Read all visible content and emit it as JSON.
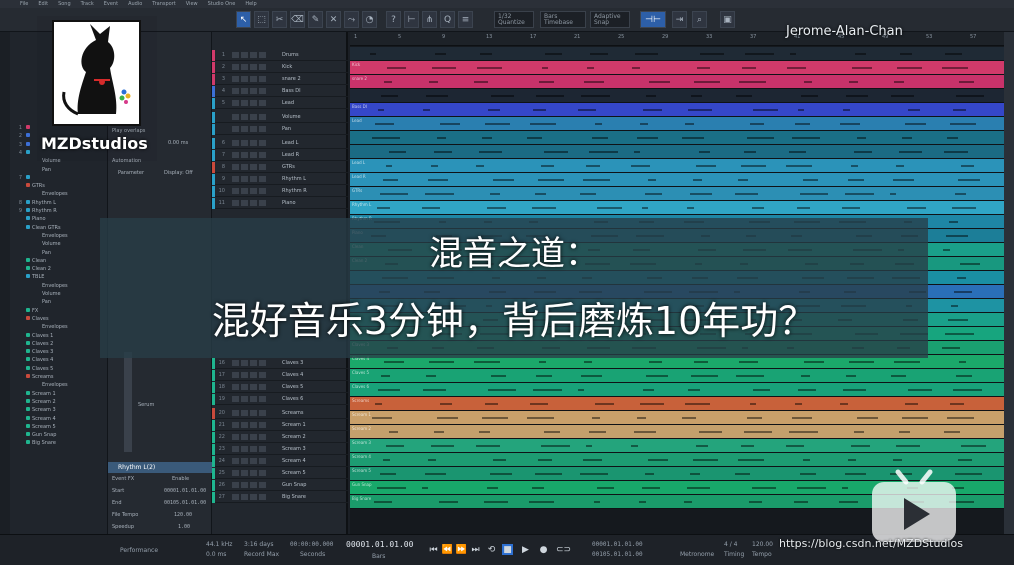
{
  "menu": [
    "File",
    "Edit",
    "Song",
    "Track",
    "Event",
    "Audio",
    "Transport",
    "View",
    "Studio One",
    "Help"
  ],
  "toolbar": {
    "quantize_value": "1/32",
    "quantize_label": "Quantize",
    "timebase_value": "Bars",
    "timebase_label": "Timebase",
    "snap_value": "Adaptive",
    "snap_label": "Snap"
  },
  "overlay": {
    "brand": "MZDstudios",
    "author": "Jerome-Alan-Chan",
    "title_line1": "混音之道：",
    "title_line2": "混好音乐3分钟，背后磨炼10年功？",
    "watermark": "https://blog.csdn.net/MZDStudios"
  },
  "browser": {
    "rows": [
      {
        "num": "1",
        "label": "",
        "color": "#d13a6a"
      },
      {
        "num": "2",
        "label": "",
        "color": "#3c6fd6"
      },
      {
        "num": "3",
        "label": "",
        "color": "#3c6fd6"
      },
      {
        "num": "4",
        "label": "",
        "color": "#2aa0c8"
      },
      {
        "num": "",
        "label": "Volume",
        "color": ""
      },
      {
        "num": "",
        "label": "Pan",
        "color": ""
      },
      {
        "num": "7",
        "label": "",
        "color": "#2aa0c8"
      },
      {
        "num": "",
        "label": "GTRs",
        "color": "#c94a3c"
      },
      {
        "num": "",
        "label": "Envelopes",
        "color": ""
      },
      {
        "num": "8",
        "label": "Rhythm L",
        "color": "#2aa0c8"
      },
      {
        "num": "9",
        "label": "Rhythm R",
        "color": "#2aa0c8"
      },
      {
        "num": "",
        "label": "Piano",
        "color": "#2aa0c8"
      },
      {
        "num": "",
        "label": "Clean GTRs",
        "color": "#2aa0c8"
      },
      {
        "num": "",
        "label": "Envelopes",
        "color": ""
      },
      {
        "num": "",
        "label": "Volume",
        "color": ""
      },
      {
        "num": "",
        "label": "Pan",
        "color": ""
      },
      {
        "num": "",
        "label": "Clean",
        "color": "#1fb58f"
      },
      {
        "num": "",
        "label": "Clean 2",
        "color": "#1fb58f"
      },
      {
        "num": "",
        "label": "TBLE",
        "color": "#2aa0c8"
      },
      {
        "num": "",
        "label": "Envelopes",
        "color": ""
      },
      {
        "num": "",
        "label": "Volume",
        "color": ""
      },
      {
        "num": "",
        "label": "Pan",
        "color": ""
      },
      {
        "num": "",
        "label": "FX",
        "color": "#1fb58f"
      },
      {
        "num": "",
        "label": "Claves",
        "color": "#c94a3c"
      },
      {
        "num": "",
        "label": "Envelopes",
        "color": ""
      },
      {
        "num": "",
        "label": "Claves 1",
        "color": "#1fb58f"
      },
      {
        "num": "",
        "label": "Claves 2",
        "color": "#1fb58f"
      },
      {
        "num": "",
        "label": "Claves 3",
        "color": "#1fb58f"
      },
      {
        "num": "",
        "label": "Claves 4",
        "color": "#1fb58f"
      },
      {
        "num": "",
        "label": "Claves 5",
        "color": "#1fb58f"
      },
      {
        "num": "",
        "label": "Screams",
        "color": "#c94a3c"
      },
      {
        "num": "",
        "label": "Envelopes",
        "color": ""
      },
      {
        "num": "",
        "label": "Scream 1",
        "color": "#1fb58f"
      },
      {
        "num": "",
        "label": "Scream 2",
        "color": "#1fb58f"
      },
      {
        "num": "",
        "label": "Scream 3",
        "color": "#1fb58f"
      },
      {
        "num": "",
        "label": "Scream 4",
        "color": "#1fb58f"
      },
      {
        "num": "",
        "label": "Scream 5",
        "color": "#1fb58f"
      },
      {
        "num": "",
        "label": "Gun Snap",
        "color": "#1fb58f"
      },
      {
        "num": "",
        "label": "Big Snare",
        "color": "#1fb58f"
      }
    ]
  },
  "inspector": {
    "play_overlaps": "Play overlaps",
    "delay": "0.00 ms",
    "automation": "Automation",
    "parameter": "Parameter",
    "display": "Display: Off",
    "event_name": "Rhythm L(2)",
    "event_fx": "Event FX",
    "enable": "Enable",
    "start_label": "Start",
    "start_value": "00001.01.01.00",
    "end_label": "End",
    "end_value": "00105.01.01.00",
    "file_tempo_label": "File Tempo",
    "file_tempo_value": "120.00",
    "speedup_label": "Speedup",
    "speedup_value": "1.00",
    "detail": "Serum"
  },
  "tracks": [
    {
      "num": "1",
      "name": "Drums",
      "color": "#d13a6a"
    },
    {
      "num": "2",
      "name": "Kick",
      "color": "#d13a6a"
    },
    {
      "num": "3",
      "name": "snare 2",
      "color": "#d13a6a"
    },
    {
      "num": "4",
      "name": "Bass DI",
      "color": "#3c6fd6"
    },
    {
      "num": "5",
      "name": "Lead",
      "color": "#2aa0c8"
    },
    {
      "num": "",
      "name": "Volume",
      "color": "#2aa0c8"
    },
    {
      "num": "",
      "name": "Pan",
      "color": "#2aa0c8"
    },
    {
      "num": "6",
      "name": "Lead L",
      "color": "#2aa0c8"
    },
    {
      "num": "7",
      "name": "Lead R",
      "color": "#2aa0c8"
    },
    {
      "num": "8",
      "name": "GTRs",
      "color": "#c94a3c"
    },
    {
      "num": "9",
      "name": "Rhythm L",
      "color": "#2aa0c8"
    },
    {
      "num": "10",
      "name": "Rhythm R",
      "color": "#2aa0c8"
    },
    {
      "num": "11",
      "name": "Piano",
      "color": "#2aa0c8"
    },
    {
      "num": "16",
      "name": "Claves 3",
      "color": "#1fb58f"
    },
    {
      "num": "17",
      "name": "Claves 4",
      "color": "#1fb58f"
    },
    {
      "num": "18",
      "name": "Claves 5",
      "color": "#1fb58f"
    },
    {
      "num": "19",
      "name": "Claves 6",
      "color": "#1fb58f"
    },
    {
      "num": "20",
      "name": "Screams",
      "color": "#c94a3c"
    },
    {
      "num": "21",
      "name": "Scream 1",
      "color": "#1fb58f"
    },
    {
      "num": "22",
      "name": "Scream 2",
      "color": "#1fb58f"
    },
    {
      "num": "23",
      "name": "Scream 3",
      "color": "#1fb58f"
    },
    {
      "num": "24",
      "name": "Scream 4",
      "color": "#1fb58f"
    },
    {
      "num": "25",
      "name": "Scream 5",
      "color": "#1fb58f"
    },
    {
      "num": "26",
      "name": "Gun Snap",
      "color": "#1fb58f"
    },
    {
      "num": "27",
      "name": "Big Snare",
      "color": "#1fb58f"
    }
  ],
  "ruler": [
    "1",
    "5",
    "9",
    "13",
    "17",
    "21",
    "25",
    "29",
    "33",
    "37",
    "41",
    "45",
    "49",
    "53",
    "57"
  ],
  "lanes": [
    {
      "name": "",
      "color": "#1f2a35"
    },
    {
      "name": "Kick",
      "color": "#d13a6a"
    },
    {
      "name": "snare 2",
      "color": "#c8326a"
    },
    {
      "name": "",
      "color": "#1d2633"
    },
    {
      "name": "Bass DI",
      "color": "#3547c9"
    },
    {
      "name": "Lead",
      "color": "#2a7fb0"
    },
    {
      "name": "",
      "color": "#1a6f86"
    },
    {
      "name": "",
      "color": "#1b6b84"
    },
    {
      "name": "Lead L",
      "color": "#2b93b9"
    },
    {
      "name": "Lead R",
      "color": "#2b93b9"
    },
    {
      "name": "GTRs",
      "color": "#2c8fb4"
    },
    {
      "name": "Rhythm L",
      "color": "#30a5c5"
    },
    {
      "name": "Rhythm R",
      "color": "#1e86a5"
    },
    {
      "name": "Piano",
      "color": "#1c7e98"
    },
    {
      "name": "Clean",
      "color": "#1aa08a"
    },
    {
      "name": "Clean 2",
      "color": "#18987f"
    },
    {
      "name": "",
      "color": "#1a8fa3"
    },
    {
      "name": "",
      "color": "#2a6fb8"
    },
    {
      "name": "",
      "color": "#1e93a3"
    },
    {
      "name": "",
      "color": "#1aa08a"
    },
    {
      "name": "",
      "color": "#17a57e"
    },
    {
      "name": "Claves 3",
      "color": "#1aa070"
    },
    {
      "name": "Claves 4",
      "color": "#1ba86a"
    },
    {
      "name": "Claves 5",
      "color": "#19a374"
    },
    {
      "name": "Claves 6",
      "color": "#18a27a"
    },
    {
      "name": "Screams",
      "color": "#c8613a"
    },
    {
      "name": "Scream 1",
      "color": "#c9a06a"
    },
    {
      "name": "Scream 2",
      "color": "#c4a06c"
    },
    {
      "name": "Scream 3",
      "color": "#24a47c"
    },
    {
      "name": "Scream 4",
      "color": "#1d9c72"
    },
    {
      "name": "Scream 5",
      "color": "#1a9570"
    },
    {
      "name": "Gun Snap",
      "color": "#18a86a"
    },
    {
      "name": "Big Snare",
      "color": "#1a9b6a"
    }
  ],
  "transport": {
    "sample_rate": "44.1 kHz",
    "sample_rate_sub": "0.0 ms",
    "record_max": "3:16 days",
    "record_max_label": "Record Max",
    "seconds": "00:00:00.000",
    "seconds_label": "Seconds",
    "bars": "00001.01.01.00",
    "bars_label": "Bars",
    "loop_start": "00001.01.01.00",
    "loop_end": "00105.01.01.00",
    "metronome_label": "Metronome",
    "timing": "4 / 4",
    "timing_label": "Timing",
    "tempo": "120.00",
    "tempo_label": "Tempo",
    "performance_label": "Performance"
  }
}
